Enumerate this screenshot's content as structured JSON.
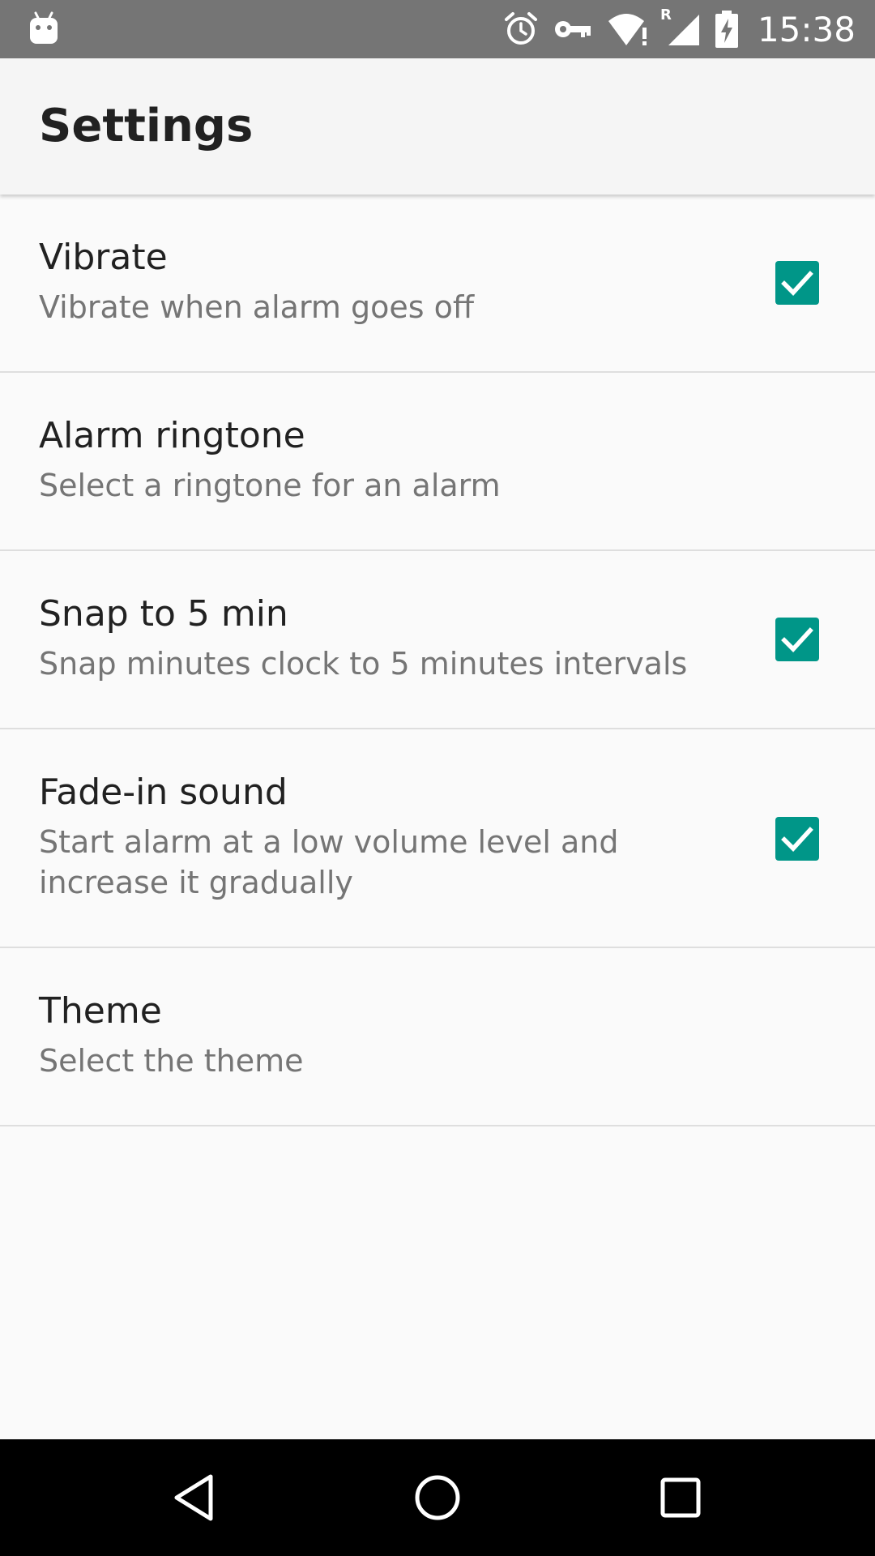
{
  "status_bar": {
    "time": "15:38",
    "icons": [
      "android-notification-icon",
      "alarm-icon",
      "vpn-key-icon",
      "wifi-alert-icon",
      "roaming-signal-icon",
      "battery-charging-icon"
    ],
    "roaming_label": "R"
  },
  "app_bar": {
    "title": "Settings"
  },
  "settings": [
    {
      "title": "Vibrate",
      "summary": "Vibrate when alarm goes off",
      "has_checkbox": true,
      "checked": true
    },
    {
      "title": "Alarm ringtone",
      "summary": "Select a ringtone for an alarm",
      "has_checkbox": false
    },
    {
      "title": "Snap to 5 min",
      "summary": "Snap minutes clock to 5 minutes intervals",
      "has_checkbox": true,
      "checked": true
    },
    {
      "title": "Fade-in sound",
      "summary": "Start alarm at a low volume level and increase it gradually",
      "has_checkbox": true,
      "checked": true
    },
    {
      "title": "Theme",
      "summary": "Select the theme",
      "has_checkbox": false
    }
  ],
  "nav_bar": {
    "icons": [
      "back-icon",
      "home-icon",
      "recents-icon"
    ]
  },
  "colors": {
    "status_bar": "#757575",
    "app_bar": "#f5f5f5",
    "background": "#fafafa",
    "accent": "#009688",
    "title_text": "#212121",
    "summary_text": "#757575",
    "divider": "#dedede",
    "nav_bar": "#000000"
  }
}
